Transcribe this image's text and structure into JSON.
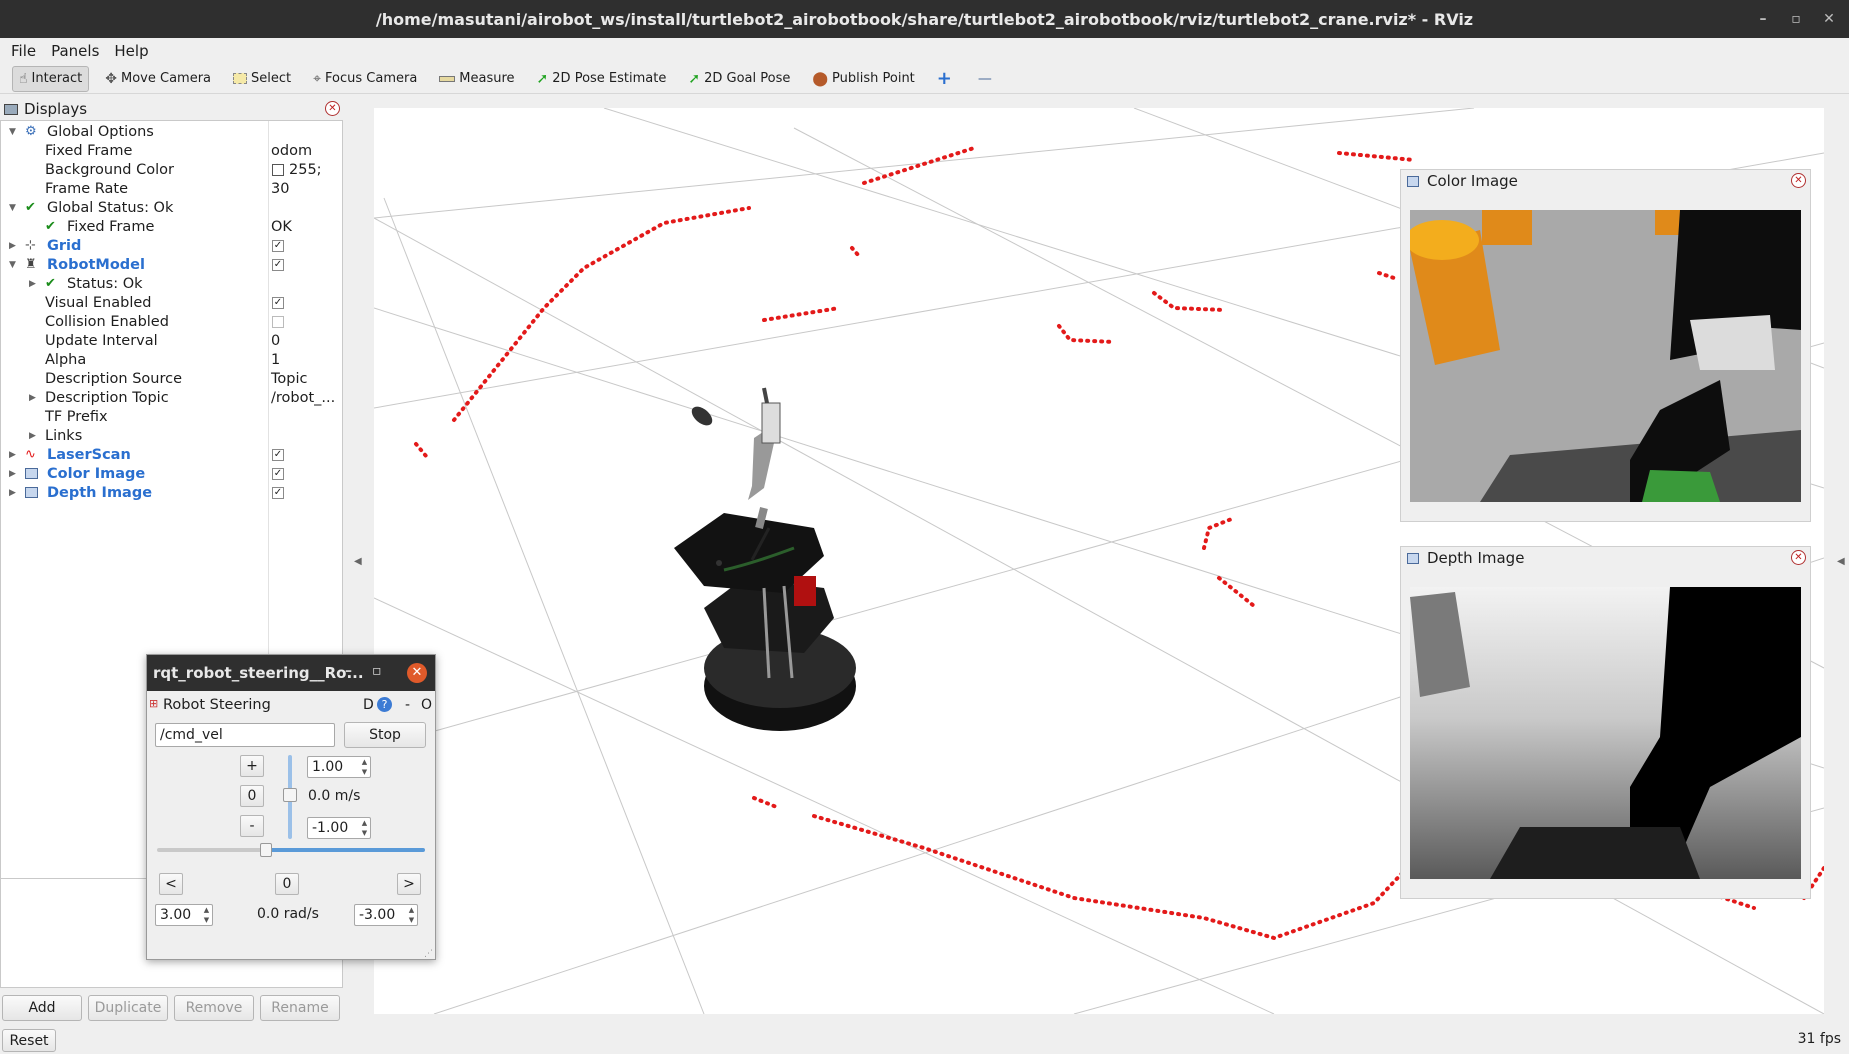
{
  "window": {
    "title": "/home/masutani/airobot_ws/install/turtlebot2_airobotbook/share/turtlebot2_airobotbook/rviz/turtlebot2_crane.rviz* - RViz",
    "min": "–",
    "max": "▫",
    "close": "✕"
  },
  "menu": {
    "file": "File",
    "panels": "Panels",
    "help": "Help"
  },
  "toolbar": {
    "interact": "Interact",
    "move_camera": "Move Camera",
    "select": "Select",
    "focus_camera": "Focus Camera",
    "measure": "Measure",
    "pose_estimate": "2D Pose Estimate",
    "goal_pose": "2D Goal Pose",
    "publish_point": "Publish Point",
    "plus": "+",
    "minus": "—"
  },
  "displays": {
    "title": "Displays",
    "rows": [
      {
        "label": "Global Options",
        "value": ""
      },
      {
        "label": "Fixed Frame",
        "value": "odom"
      },
      {
        "label": "Background Color",
        "value": "255;"
      },
      {
        "label": "Frame Rate",
        "value": "30"
      },
      {
        "label": "Global Status: Ok",
        "value": ""
      },
      {
        "label": "Fixed Frame",
        "value": "OK"
      },
      {
        "label": "Grid",
        "value": ""
      },
      {
        "label": "RobotModel",
        "value": ""
      },
      {
        "label": "Status: Ok",
        "value": ""
      },
      {
        "label": "Visual Enabled",
        "value": ""
      },
      {
        "label": "Collision Enabled",
        "value": ""
      },
      {
        "label": "Update Interval",
        "value": "0"
      },
      {
        "label": "Alpha",
        "value": "1"
      },
      {
        "label": "Description Source",
        "value": "Topic"
      },
      {
        "label": "Description Topic",
        "value": "/robot_..."
      },
      {
        "label": "TF Prefix",
        "value": ""
      },
      {
        "label": "Links",
        "value": ""
      },
      {
        "label": "LaserScan",
        "value": ""
      },
      {
        "label": "Color Image",
        "value": ""
      },
      {
        "label": "Depth Image",
        "value": ""
      }
    ],
    "checked": {
      "grid": true,
      "robotmodel": true,
      "visual": true,
      "collision": false,
      "laserscan": true,
      "color_image": true,
      "depth_image": true
    }
  },
  "buttons": {
    "add": "Add",
    "duplicate": "Duplicate",
    "remove": "Remove",
    "rename": "Rename",
    "reset": "Reset"
  },
  "fps": "31 fps",
  "color_panel": {
    "title": "Color Image"
  },
  "depth_panel": {
    "title": "Depth Image"
  },
  "steering": {
    "title": "rqt_robot_steering__Ro...",
    "plugin": "Robot Steering",
    "d": "D",
    "help": "?",
    "dash": "-",
    "o": "O",
    "topic": "/cmd_vel",
    "stop": "Stop",
    "plus": "+",
    "zero": "0",
    "minus": "-",
    "lin_max": "1.00",
    "lin_val": "0.0 m/s",
    "lin_min": "-1.00",
    "left": "<",
    "right": ">",
    "ang_zero": "0",
    "ang_max": "3.00",
    "ang_val": "0.0 rad/s",
    "ang_min": "-3.00"
  },
  "colors": {
    "laser": "#e31a1a",
    "accent": "#2a6fcf",
    "title_bg": "#2f2f2f"
  }
}
